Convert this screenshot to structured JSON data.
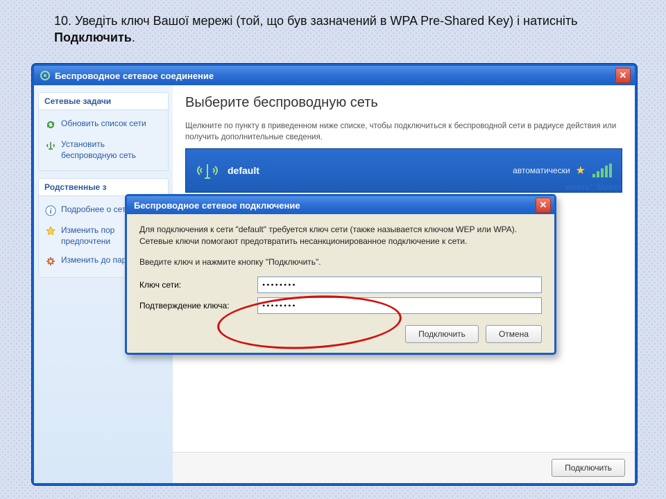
{
  "instruction_prefix": "10. Уведіть ключ Вашої мережі (той, що був зазначений в WPA Pre-Shared Key) і натисніть ",
  "instruction_bold": "Подключить",
  "instruction_suffix": ".",
  "mainWindow": {
    "title": "Беспроводное сетевое соединение",
    "heading": "Выберите беспроводную сеть",
    "subtext": "Щелкните по пункту в приведенном ниже списке, чтобы подключиться к беспроводной сети в радиусе действия или получить дополнительные сведения.",
    "connectBtn": "Подключить"
  },
  "sidebar": {
    "block1": {
      "title": "Сетевые задачи",
      "items": [
        "Обновить список сети",
        "Установить беспроводную сеть"
      ]
    },
    "block2": {
      "title": "Родственные задачи",
      "items": [
        "Подробнее о беспроводных сетях",
        "Изменить порядок предпочтения сетей",
        "Изменить дополнительные параметры"
      ]
    },
    "block2_visible": {
      "title": "Родственные з",
      "items": [
        "Подробнее о сетях",
        "Изменить пор предпочтени",
        "Изменить до параметры"
      ]
    }
  },
  "network": {
    "name": "default",
    "mode": "автоматически"
  },
  "fragment": "ючить\". Может",
  "dialog": {
    "title": "Беспроводное сетевое подключение",
    "text1": "Для подключения к сети \"default\" требуется ключ сети (также называется ключом WEP или WPA). Сетевые ключи помогают предотвратить несанкционированное подключение к сети.",
    "text2": "Введите ключ и нажмите кнопку \"Подключить\".",
    "keyLabel": "Ключ сети:",
    "confirmLabel": "Подтверждение ключа:",
    "keyValue": "••••••••",
    "confirmValue": "••••••••",
    "connectBtn": "Подключить",
    "cancelBtn": "Отмена"
  }
}
